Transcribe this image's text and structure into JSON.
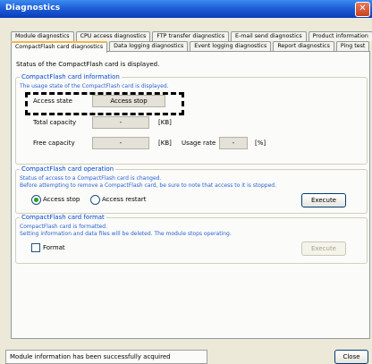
{
  "window": {
    "title": "Diagnostics"
  },
  "tabs_row1": [
    {
      "label": "Module diagnostics"
    },
    {
      "label": "CPU access diagnostics"
    },
    {
      "label": "FTP transfer diagnostics"
    },
    {
      "label": "E-mail send diagnostics"
    },
    {
      "label": "Product information"
    }
  ],
  "tabs_row2": [
    {
      "label": "CompactFlash card diagnostics",
      "active": true
    },
    {
      "label": "Data logging diagnostics"
    },
    {
      "label": "Event logging diagnostics"
    },
    {
      "label": "Report diagnostics"
    },
    {
      "label": "Ping test"
    }
  ],
  "panel": {
    "status_text": "Status of the CompactFlash card is displayed."
  },
  "card_info": {
    "legend": "CompactFlash card information",
    "desc": "The usage state of the CompactFlash card is displayed.",
    "access_state_label": "Access state",
    "access_state_value": "Access stop",
    "total_capacity_label": "Total capacity",
    "total_capacity_value": "-",
    "total_capacity_unit": "[KB]",
    "free_capacity_label": "Free capacity",
    "free_capacity_value": "-",
    "free_capacity_unit": "[KB]",
    "usage_rate_label": "Usage rate",
    "usage_rate_value": "-",
    "usage_rate_unit": "[%]"
  },
  "card_operation": {
    "legend": "CompactFlash card operation",
    "desc1": "Status of access to a CompactFlash card is changed.",
    "desc2": "Before attempting to remove a CompactFlash card, be sure to note that access to it is stopped.",
    "option_stop": "Access stop",
    "option_restart": "Access restart",
    "selected": "Access stop",
    "execute_label": "Execute"
  },
  "card_format": {
    "legend": "CompactFlash card format",
    "desc1": "CompactFlash card is formatted.",
    "desc2": "Setting information and data files will be deleted. The module stops operating.",
    "format_label": "Format",
    "format_checked": false,
    "execute_label": "Execute"
  },
  "status_bar": {
    "message": "Module information has been successfully acquired"
  },
  "footer": {
    "close_label": "Close"
  },
  "colors": {
    "titlebar": "#1f5ed8",
    "group_legend": "#0046d5",
    "panel_bg": "#fbfbf9"
  }
}
